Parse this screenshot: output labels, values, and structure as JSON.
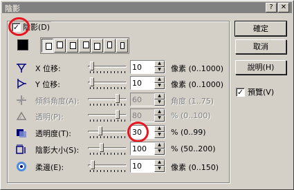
{
  "window": {
    "title": "陰影",
    "help_glyph": "?",
    "close_glyph": "✕"
  },
  "shadow": {
    "label": "陰影(D)",
    "checked_glyph": "✓"
  },
  "colors": {
    "annotation": "#e8141e"
  },
  "rows": [
    {
      "label": "X 位移:",
      "value": "10",
      "range": "像素 (0..1000)",
      "slider": 0.05
    },
    {
      "label": "Y 位移:",
      "value": "10",
      "range": "像素 (0..1000)",
      "slider": 0.05
    },
    {
      "label": "傾斜角度(A):",
      "value": "60",
      "range": "角度 (1..75)",
      "slider": 0.8
    },
    {
      "label": "透明(P):",
      "value": "80",
      "range": "% (0..100)",
      "slider": 0.8
    },
    {
      "label": "透明度(T):",
      "value": "30",
      "range": "% (0..99)",
      "slider": 0.3
    },
    {
      "label": "陰影大小(S):",
      "value": "100",
      "range": "% (50..200)",
      "slider": 0.33
    },
    {
      "label": "柔邊(E):",
      "value": "10",
      "range": "像素 (0..150)",
      "slider": 0.07
    }
  ],
  "buttons": {
    "ok": "確定",
    "cancel": "取消",
    "help": "說明(H)"
  },
  "preview": {
    "label": "預覽(V)",
    "checked_glyph": "✓"
  }
}
